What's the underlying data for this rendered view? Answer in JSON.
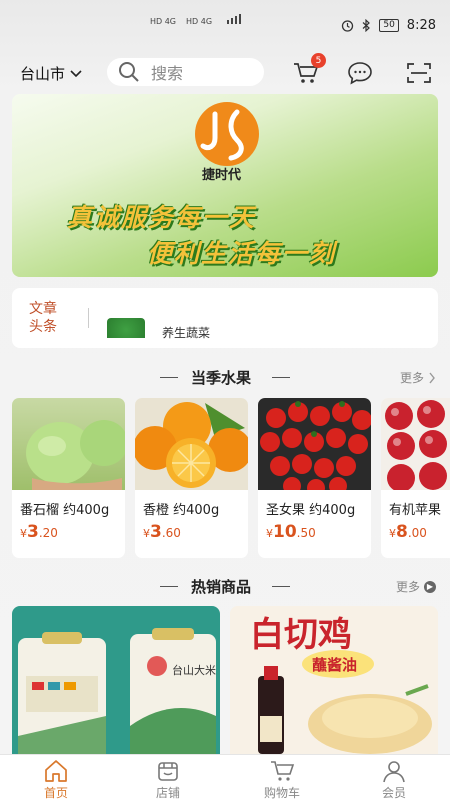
{
  "status_bar": {
    "network_1": "HD 4G",
    "network_2": "HD 4G",
    "battery": "50",
    "time": "8:28"
  },
  "header": {
    "city": "台山市",
    "search_placeholder": "搜索",
    "cart_badge": "5"
  },
  "banner": {
    "brand": "捷时代",
    "slogan_1": "真诚服务每一天",
    "slogan_2": "便利生活每一刻"
  },
  "news": {
    "tag": "文章头条",
    "headline": "养生蔬菜"
  },
  "section_fruit": {
    "title": "当季水果",
    "more": "更多"
  },
  "fruits": [
    {
      "name": "番石榴 约400g",
      "currency": "¥",
      "price_int": "3",
      "price_dec": ".20",
      "image": "guava"
    },
    {
      "name": "香橙 约400g",
      "currency": "¥",
      "price_int": "3",
      "price_dec": ".60",
      "image": "orange"
    },
    {
      "name": "圣女果 约400g",
      "currency": "¥",
      "price_int": "10",
      "price_dec": ".50",
      "image": "cherry-tomato"
    },
    {
      "name": "有机苹果",
      "currency": "¥",
      "price_int": "8",
      "price_dec": ".00",
      "image": "apple"
    }
  ],
  "section_hot": {
    "title": "热销商品",
    "more": "更多"
  },
  "hot_products": [
    {
      "image": "rice-bags",
      "bag_text": "台山大米"
    },
    {
      "image": "white-cut-chicken",
      "poster_title": "白切鸡",
      "poster_sub": "蘸酱油"
    }
  ],
  "tabbar": {
    "items": [
      {
        "label": "首页",
        "icon": "home-icon"
      },
      {
        "label": "店铺",
        "icon": "store-icon"
      },
      {
        "label": "购物车",
        "icon": "cart-icon"
      },
      {
        "label": "会员",
        "icon": "user-icon"
      }
    ],
    "active_color": "#d9782c"
  }
}
